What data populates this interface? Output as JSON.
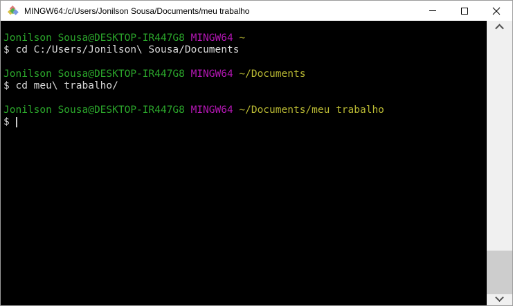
{
  "window": {
    "title": "MINGW64:/c/Users/Jonilson Sousa/Documents/meu trabalho"
  },
  "icons": {
    "app": "git-bash-diamond-icon",
    "minimize": "minimize-icon",
    "maximize": "maximize-icon",
    "close": "close-icon",
    "scroll_up": "chevron-up-icon",
    "scroll_down": "chevron-down-icon"
  },
  "terminal": {
    "colors": {
      "background": "#000000",
      "foreground": "#d8d8d8",
      "user_host_green": "#2ba62b",
      "mingw_magenta": "#b517b5",
      "path_yellow": "#b8b833",
      "cursor": "#c8c8c8"
    },
    "lines": [
      {
        "type": "prompt",
        "user": "Jonilson Sousa@DESKTOP-IR447G8",
        "host": "MINGW64",
        "path": "~"
      },
      {
        "type": "command",
        "text": "$ cd C:/Users/Jonilson\\ Sousa/Documents"
      },
      {
        "type": "blank"
      },
      {
        "type": "prompt",
        "user": "Jonilson Sousa@DESKTOP-IR447G8",
        "host": "MINGW64",
        "path": "~/Documents"
      },
      {
        "type": "command",
        "text": "$ cd meu\\ trabalho/"
      },
      {
        "type": "blank"
      },
      {
        "type": "prompt",
        "user": "Jonilson Sousa@DESKTOP-IR447G8",
        "host": "MINGW64",
        "path": "~/Documents/meu trabalho"
      },
      {
        "type": "command_with_cursor",
        "text": "$ "
      }
    ]
  }
}
